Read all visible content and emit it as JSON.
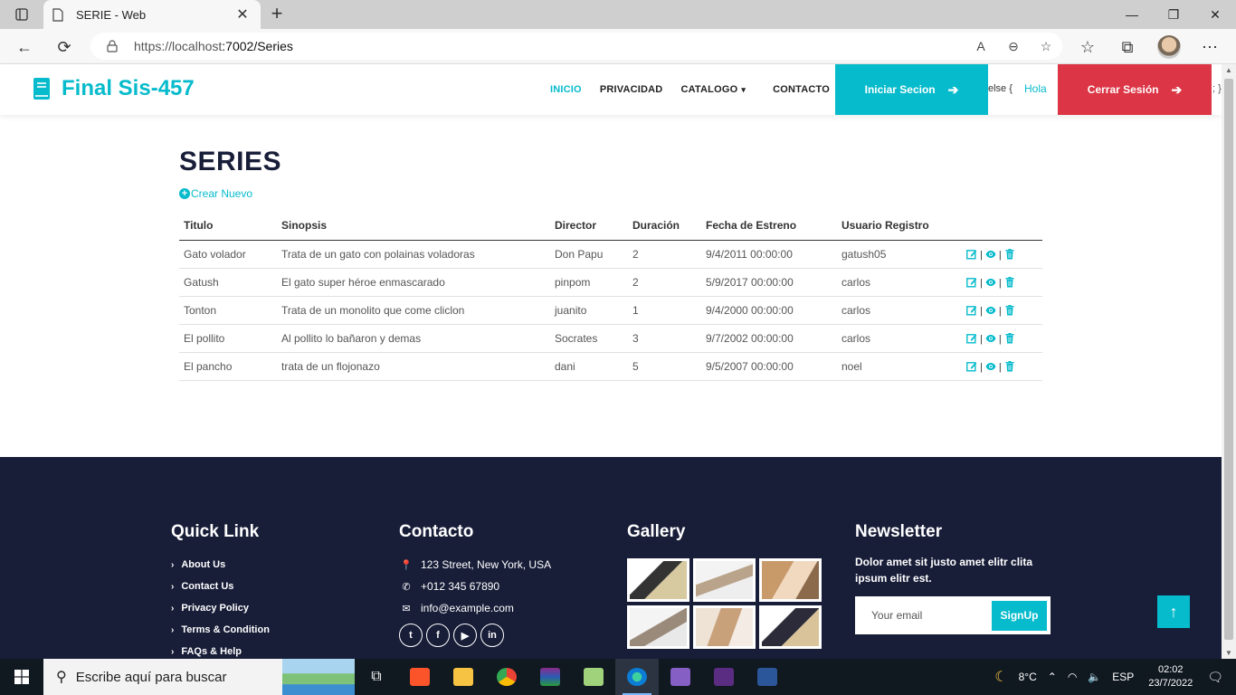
{
  "browser": {
    "tab_title": "SERIE - Web",
    "close_tab": "✕",
    "new_tab": "+",
    "url_host": "https://localhost",
    "url_rest": ":7002/Series"
  },
  "navbar": {
    "brand": "Final Sis-457",
    "links": [
      "INICIO",
      "PRIVACIDAD",
      "CATALOGO",
      "CONTACTO"
    ],
    "login_label": "Iniciar Secion",
    "else_text": "else {",
    "hola": "Hola",
    "logout_label": "Cerrar Sesión",
    "brace": "; }"
  },
  "main": {
    "title": "SERIES",
    "create_label": "Crear Nuevo",
    "columns": [
      "Titulo",
      "Sinopsis",
      "Director",
      "Duración",
      "Fecha de Estreno",
      "Usuario Registro",
      ""
    ],
    "rows": [
      [
        "Gato volador",
        "Trata de un gato con polainas voladoras",
        "Don Papu",
        "2",
        "9/4/2011 00:00:00",
        "gatush05"
      ],
      [
        "Gatush",
        "El gato super héroe enmascarado",
        "pinpom",
        "2",
        "5/9/2017 00:00:00",
        "carlos"
      ],
      [
        "Tonton",
        "Trata de un monolito que come cliclon",
        "juanito",
        "1",
        "9/4/2000 00:00:00",
        "carlos"
      ],
      [
        "El pollito",
        "Al pollito lo bañaron y demas",
        "Socrates",
        "3",
        "9/7/2002 00:00:00",
        "carlos"
      ],
      [
        "El pancho",
        "trata de un flojonazo",
        "dani",
        "5",
        "9/5/2007 00:00:00",
        "noel"
      ]
    ],
    "action_sep": "|"
  },
  "footer": {
    "quick_link_title": "Quick Link",
    "quick_links": [
      "About Us",
      "Contact Us",
      "Privacy Policy",
      "Terms & Condition",
      "FAQs & Help"
    ],
    "contact_title": "Contacto",
    "address": "123 Street, New York, USA",
    "phone": "+012 345 67890",
    "email": "info@example.com",
    "socials": [
      "twitter-icon",
      "facebook-icon",
      "youtube-icon",
      "linkedin-icon"
    ],
    "gallery_title": "Gallery",
    "newsletter_title": "Newsletter",
    "newsletter_text": "Dolor amet sit justo amet elitr clita ipsum elitr est.",
    "email_placeholder": "Your email",
    "signup_label": "SignUp"
  },
  "taskbar": {
    "search_placeholder": "Escribe aquí para buscar",
    "temperature": "8°C",
    "language": "ESP",
    "time": "02:02",
    "date": "23/7/2022"
  },
  "colors": {
    "accent": "#06bbcc",
    "danger": "#dc3545",
    "footer_bg": "#181d38"
  }
}
